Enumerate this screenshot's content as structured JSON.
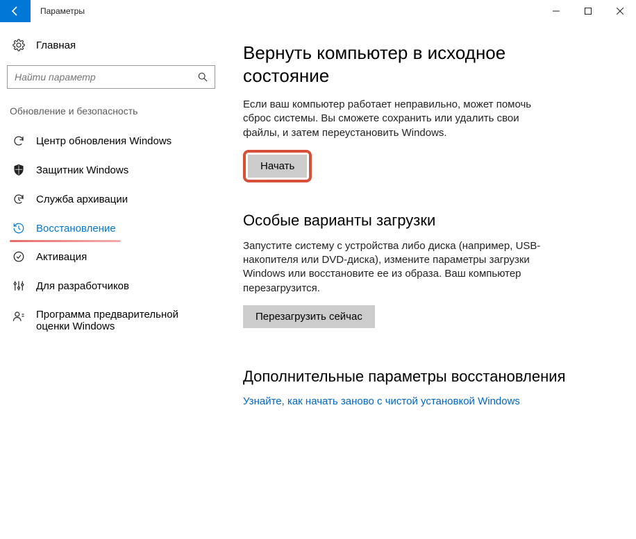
{
  "window": {
    "title": "Параметры"
  },
  "sidebar": {
    "home_label": "Главная",
    "search_placeholder": "Найти параметр",
    "category_label": "Обновление и безопасность",
    "items": [
      {
        "label": "Центр обновления Windows"
      },
      {
        "label": "Защитник Windows"
      },
      {
        "label": "Служба архивации"
      },
      {
        "label": "Восстановление"
      },
      {
        "label": "Активация"
      },
      {
        "label": "Для разработчиков"
      },
      {
        "label": "Программа предварительной оценки Windows"
      }
    ]
  },
  "main": {
    "section1": {
      "title": "Вернуть компьютер в исходное состояние",
      "body": "Если ваш компьютер работает неправильно, может помочь сброс системы. Вы сможете сохранить или удалить свои файлы, и затем переустановить Windows.",
      "button": "Начать"
    },
    "section2": {
      "title": "Особые варианты загрузки",
      "body": "Запустите систему с устройства либо диска (например, USB-накопителя или DVD-диска), измените параметры загрузки Windows или восстановите ее из образа. Ваш компьютер перезагрузится.",
      "button": "Перезагрузить сейчас"
    },
    "section3": {
      "title": "Дополнительные параметры восстановления",
      "link": "Узнайте, как начать заново с чистой установкой Windows"
    }
  }
}
